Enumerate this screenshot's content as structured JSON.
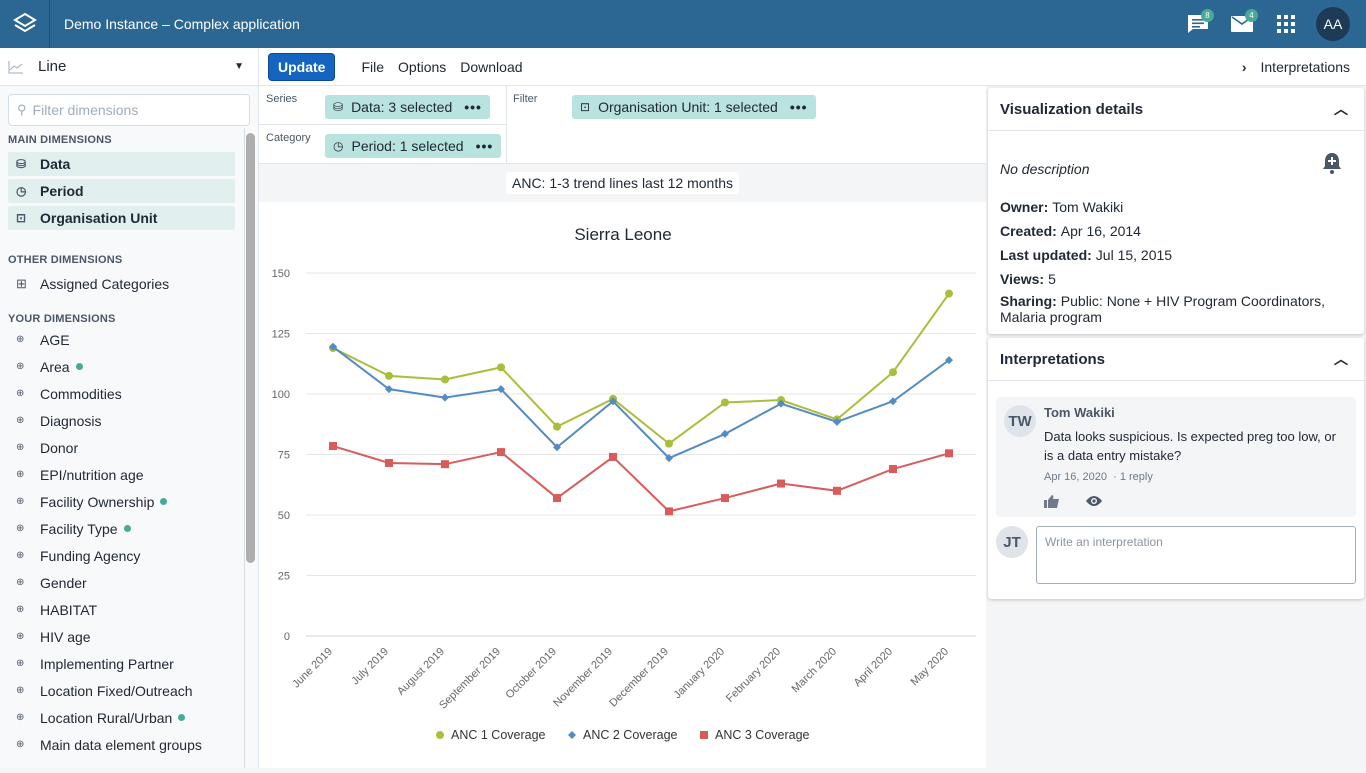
{
  "header": {
    "app_title": "Demo Instance – Complex application",
    "messages_badge": "8",
    "mail_badge": "4",
    "avatar_initials": "AA"
  },
  "sidebar": {
    "vis_type": "Line",
    "filter_placeholder": "Filter dimensions",
    "main_title": "MAIN DIMENSIONS",
    "main_items": [
      {
        "label": "Data",
        "icon": "database-icon"
      },
      {
        "label": "Period",
        "icon": "clock-icon"
      },
      {
        "label": "Organisation Unit",
        "icon": "org-unit-icon"
      }
    ],
    "other_title": "OTHER DIMENSIONS",
    "other_items": [
      {
        "label": "Assigned Categories",
        "icon": "table-icon"
      }
    ],
    "your_title": "YOUR DIMENSIONS",
    "your_items": [
      {
        "label": "AGE",
        "active": false
      },
      {
        "label": "Area",
        "active": true
      },
      {
        "label": "Commodities",
        "active": false
      },
      {
        "label": "Diagnosis",
        "active": false
      },
      {
        "label": "Donor",
        "active": false
      },
      {
        "label": "EPI/nutrition age",
        "active": false
      },
      {
        "label": "Facility Ownership",
        "active": true
      },
      {
        "label": "Facility Type",
        "active": true
      },
      {
        "label": "Funding Agency",
        "active": false
      },
      {
        "label": "Gender",
        "active": false
      },
      {
        "label": "HABITAT",
        "active": false
      },
      {
        "label": "HIV age",
        "active": false
      },
      {
        "label": "Implementing Partner",
        "active": false
      },
      {
        "label": "Location Fixed/Outreach",
        "active": false
      },
      {
        "label": "Location Rural/Urban",
        "active": true
      },
      {
        "label": "Main data element groups",
        "active": false
      }
    ]
  },
  "menubar": {
    "update": "Update",
    "file": "File",
    "options": "Options",
    "download": "Download",
    "interpretations": "Interpretations"
  },
  "layout": {
    "series_label": "Series",
    "category_label": "Category",
    "filter_label": "Filter",
    "series_chip": "Data: 3 selected",
    "category_chip": "Period: 1 selected",
    "filter_chip": "Organisation Unit: 1 selected",
    "more": "•••"
  },
  "visualization_title": "ANC: 1-3 trend lines last 12 months",
  "colors": {
    "anc1": "#a9be3b",
    "anc2": "#558cc0",
    "anc3": "#d95c5c",
    "accent": "#2c6693"
  },
  "chart_data": {
    "type": "line",
    "title": "Sierra Leone",
    "xlabel": "",
    "ylabel": "",
    "ylim": [
      0,
      150
    ],
    "yticks": [
      0,
      25,
      50,
      75,
      100,
      125,
      150
    ],
    "grid": true,
    "legend": "bottom",
    "categories": [
      "June 2019",
      "July 2019",
      "August 2019",
      "September 2019",
      "October 2019",
      "November 2019",
      "December 2019",
      "January 2020",
      "February 2020",
      "March 2020",
      "April 2020",
      "May 2020"
    ],
    "series": [
      {
        "name": "ANC 1 Coverage",
        "marker": "circle",
        "values": [
          119,
          107.5,
          106,
          111,
          86.5,
          98,
          79.5,
          96.5,
          97.5,
          89.5,
          109,
          141.5
        ]
      },
      {
        "name": "ANC 2 Coverage",
        "marker": "diamond",
        "values": [
          119.5,
          102,
          98.5,
          102,
          78,
          97,
          73.5,
          83.5,
          96,
          88.5,
          97,
          114
        ]
      },
      {
        "name": "ANC 3 Coverage",
        "marker": "square",
        "values": [
          78.5,
          71.5,
          71,
          76,
          57,
          74,
          51.5,
          57,
          63,
          60,
          69,
          75.5
        ]
      }
    ]
  },
  "details": {
    "title": "Visualization details",
    "description": "No description",
    "owner_label": "Owner:",
    "owner": "Tom Wakiki",
    "created_label": "Created:",
    "created": "Apr 16, 2014",
    "updated_label": "Last updated:",
    "updated": "Jul 15, 2015",
    "views_label": "Views:",
    "views": "5",
    "sharing_label": "Sharing:",
    "sharing": "Public: None + HIV Program Coordinators, Malaria program"
  },
  "interpretations": {
    "title": "Interpretations",
    "items": [
      {
        "initials": "TW",
        "author": "Tom Wakiki",
        "text": "Data looks suspicious. Is expected preg too low, or is a data entry mistake?",
        "date": "Apr 16, 2020",
        "replies": "· 1 reply"
      }
    ],
    "user_initials": "JT",
    "write_placeholder": "Write an interpretation"
  }
}
